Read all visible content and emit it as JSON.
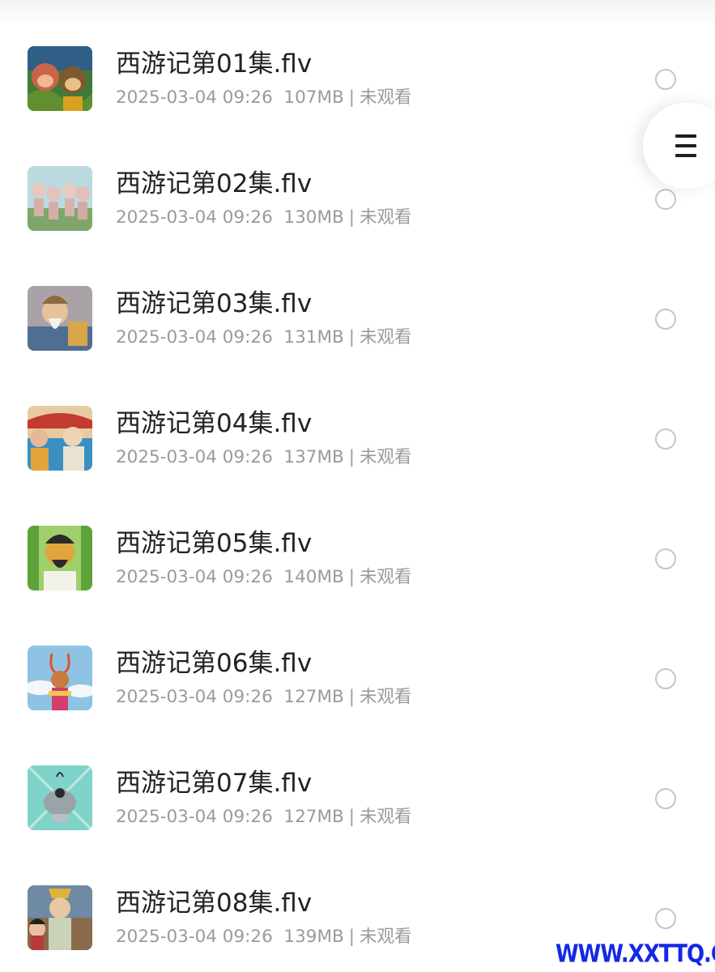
{
  "files": [
    {
      "name": "西游记第01集.flv",
      "date": "2025-03-04 09:26",
      "size": "107MB",
      "separator": "|",
      "status": "未观看",
      "thumbnail_icon": "video-thumbnail"
    },
    {
      "name": "西游记第02集.flv",
      "date": "2025-03-04 09:26",
      "size": "130MB",
      "separator": "|",
      "status": "未观看",
      "thumbnail_icon": "video-thumbnail"
    },
    {
      "name": "西游记第03集.flv",
      "date": "2025-03-04 09:26",
      "size": "131MB",
      "separator": "|",
      "status": "未观看",
      "thumbnail_icon": "video-thumbnail"
    },
    {
      "name": "西游记第04集.flv",
      "date": "2025-03-04 09:26",
      "size": "137MB",
      "separator": "|",
      "status": "未观看",
      "thumbnail_icon": "video-thumbnail"
    },
    {
      "name": "西游记第05集.flv",
      "date": "2025-03-04 09:26",
      "size": "140MB",
      "separator": "|",
      "status": "未观看",
      "thumbnail_icon": "video-thumbnail"
    },
    {
      "name": "西游记第06集.flv",
      "date": "2025-03-04 09:26",
      "size": "127MB",
      "separator": "|",
      "status": "未观看",
      "thumbnail_icon": "video-thumbnail"
    },
    {
      "name": "西游记第07集.flv",
      "date": "2025-03-04 09:26",
      "size": "127MB",
      "separator": "|",
      "status": "未观看",
      "thumbnail_icon": "video-thumbnail"
    },
    {
      "name": "西游记第08集.flv",
      "date": "2025-03-04 09:26",
      "size": "139MB",
      "separator": "|",
      "status": "未观看",
      "thumbnail_icon": "video-thumbnail"
    }
  ],
  "side_menu": {
    "icon": "hamburger-menu-icon"
  },
  "watermark": {
    "text": "WWW.XXTTQ.COM"
  },
  "colors": {
    "title_text": "#222222",
    "meta_text": "#9a9a9a",
    "radio_border": "#c6c6c6",
    "watermark": "#1428e6"
  }
}
